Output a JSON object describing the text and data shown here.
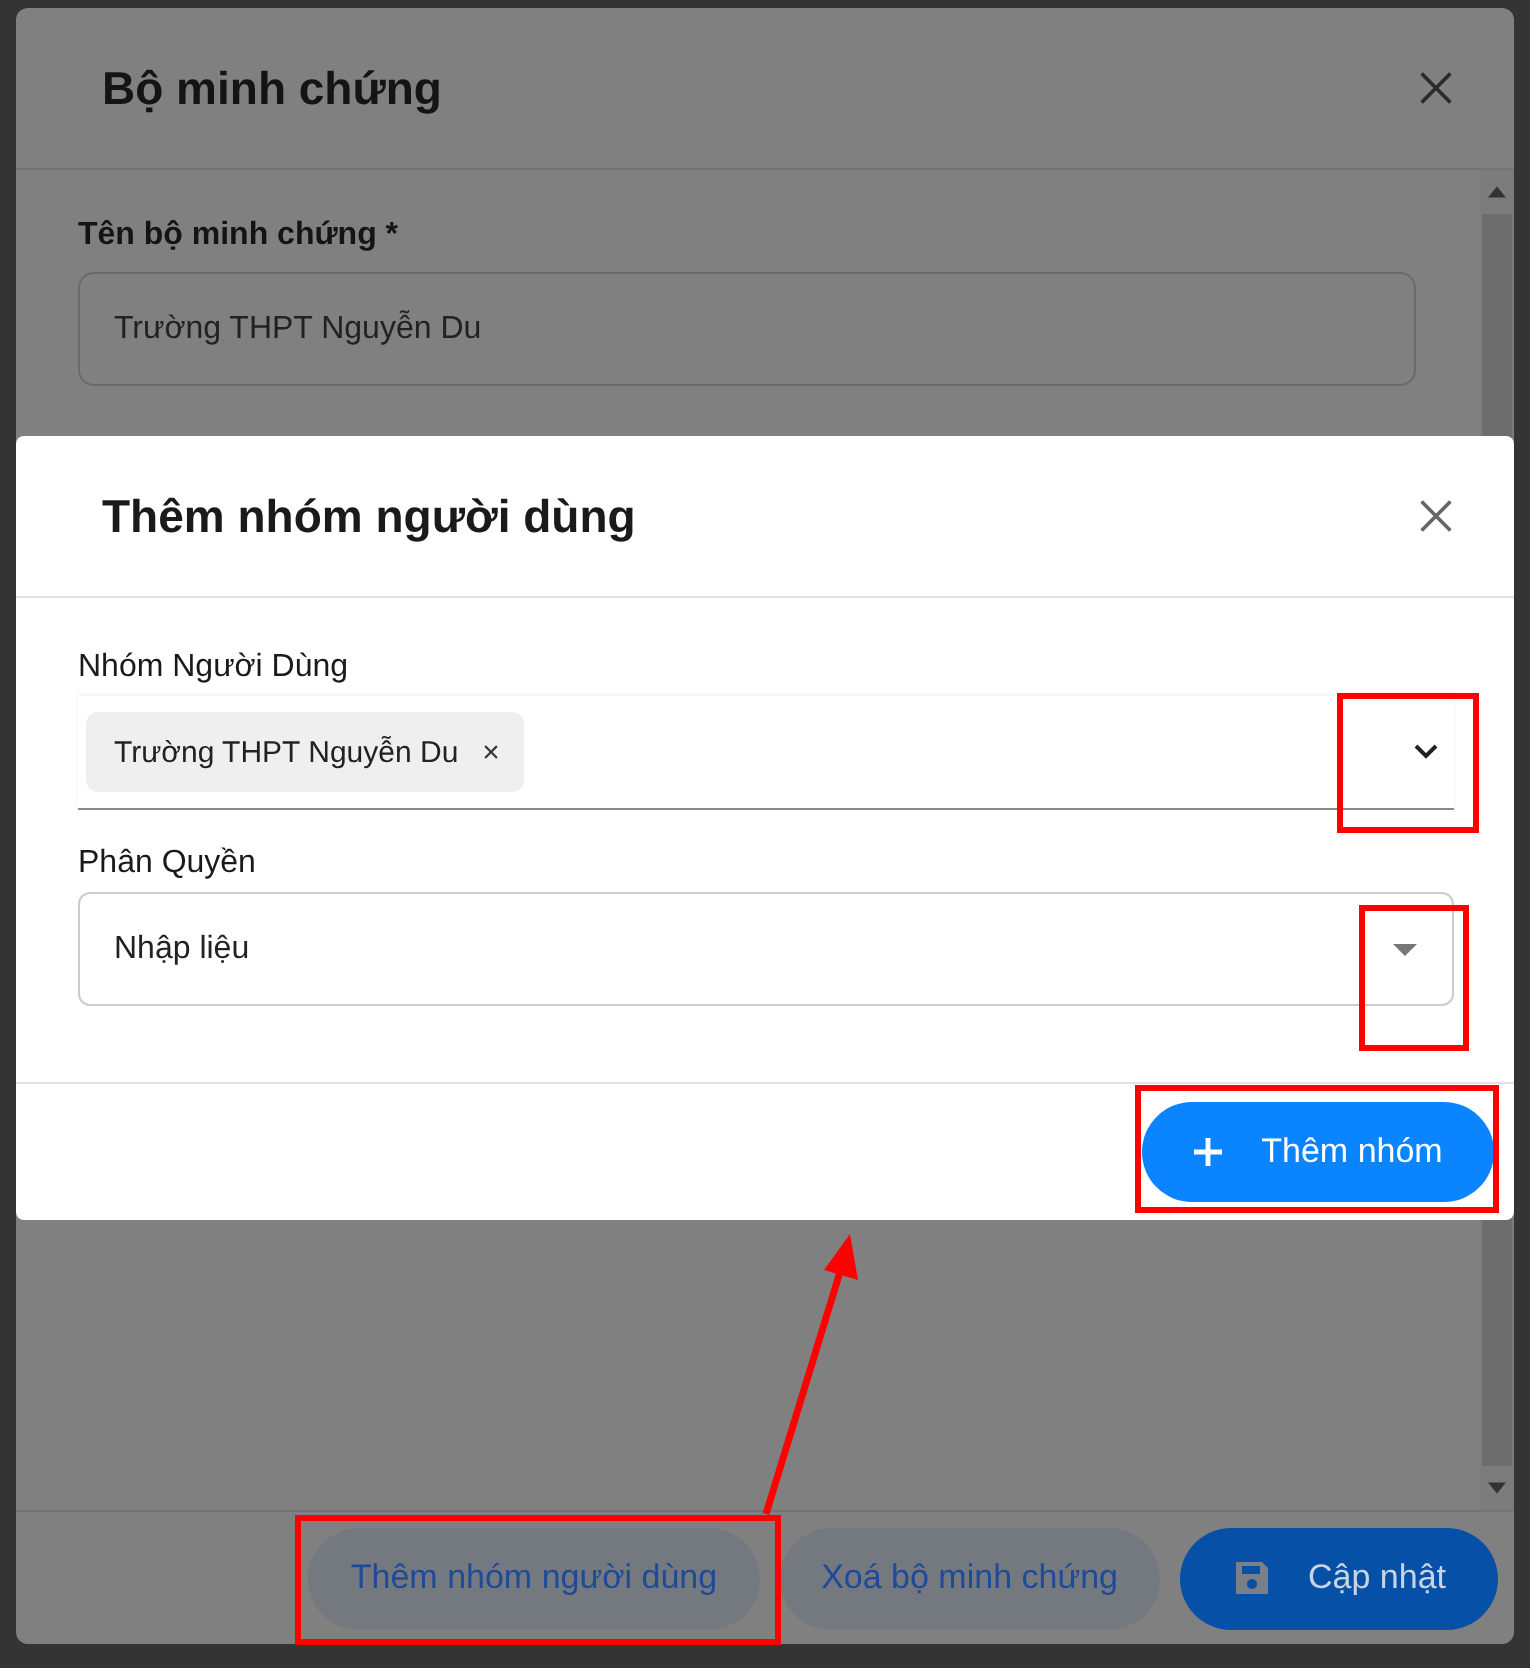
{
  "outer_dialog": {
    "title": "Bộ minh chứng",
    "field": {
      "label": "Tên bộ minh chứng *",
      "value": "Trường THPT Nguyễn Du"
    },
    "buttons": [
      {
        "label": "Thêm nhóm người dùng",
        "kind": "secondary",
        "highlighted": true
      },
      {
        "label": "Xoá bộ minh chứng",
        "kind": "secondary",
        "highlighted": false
      },
      {
        "label": "Cập nhật",
        "kind": "primary",
        "highlighted": false
      }
    ]
  },
  "dialog": {
    "title": "Thêm nhóm người dùng",
    "fields": [
      {
        "label": "Nhóm Người Dùng",
        "kind": "chips",
        "chips": [
          {
            "label": "Trường THPT Nguyễn Du",
            "remove": "×"
          }
        ],
        "highlighted": true
      },
      {
        "label": "Phân Quyền",
        "kind": "select",
        "value": "Nhập liệu",
        "highlighted": true
      }
    ],
    "button": {
      "label": "Thêm nhóm",
      "highlighted": true
    }
  }
}
